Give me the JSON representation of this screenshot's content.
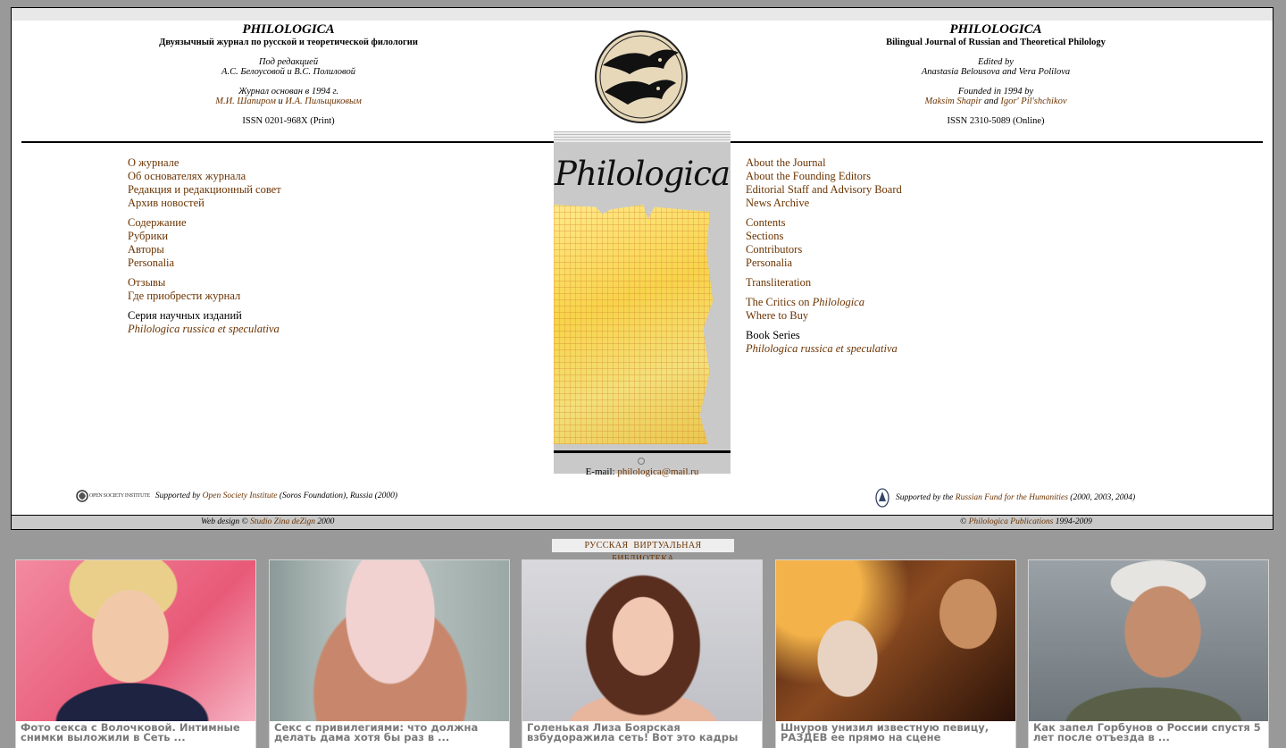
{
  "header_ru": {
    "title": "PHILOLOGICA",
    "subtitle": "Двуязычный журнал по русской и теоретической филологии",
    "edited_label": "Под редакцией",
    "editors": "А.С. Белоусовой и В.С. Полиловой",
    "founded_label": "Журнал основан в 1994 г.",
    "founder1": "М.И. Шапиром",
    "founder_conj": "и",
    "founder2": "И.А. Пильщиковым",
    "issn": "ISSN 0201-968X (Print)"
  },
  "header_en": {
    "title": "PHILOLOGICA",
    "subtitle": "Bilingual Journal of Russian and Theoretical Philology",
    "edited_label": "Edited by",
    "editors": "Anastasia Belousova and Vera Polilova",
    "founded_label": "Founded in 1994 by",
    "founder1": "Maksim Shapir",
    "founder_conj": "and",
    "founder2": "Igor' Pil'shchikov",
    "issn": "ISSN 2310-5089 (Online)"
  },
  "cover": {
    "title": "Philologica",
    "email_label": "E-mail:",
    "email": "philologica@mail.ru"
  },
  "menu_ru": {
    "about": "О журнале",
    "founders": "Об основателях журнала",
    "editorial": "Редакция и редакционный совет",
    "news": "Архив новостей",
    "contents": "Содержание",
    "sections": "Рубрики",
    "authors": "Авторы",
    "personalia": "Personalia",
    "reviews": "Отзывы",
    "buy": "Где приобрести журнал",
    "series_label": "Серия научных изданий",
    "series": "Philologica russica et speculativa"
  },
  "menu_en": {
    "about": "About the Journal",
    "founders": "About the Founding Editors",
    "editorial": "Editorial Staff and Advisory Board",
    "news": "News Archive",
    "contents": "Contents",
    "sections": "Sections",
    "contributors": "Contributors",
    "personalia": "Personalia",
    "transliteration": "Transliteration",
    "critics_prefix": "The Critics on",
    "critics_journal": "Philologica",
    "buy": "Where to Buy",
    "series_label": "Book Series",
    "series": "Philologica russica et speculativa"
  },
  "support_ru": {
    "logo_text": "OPEN SOCIETY INSTITUTE",
    "prefix": "Supported by",
    "link": "Open Society Institute",
    "suffix": "(Soros Foundation), Russia (2000)"
  },
  "support_en": {
    "prefix": "Supported by the",
    "link": "Russian Fund for the Humanities",
    "suffix": "(2000, 2003, 2004)"
  },
  "footer": {
    "design_prefix": "Web design ©",
    "design_link": "Studio Zina deZign",
    "design_year": "2000",
    "copy_prefix": "©",
    "copy_link": "Philologica Publications",
    "copy_years": "1994-2009"
  },
  "library_link": "РУССКАЯ ВИРТУАЛЬНАЯ БИБЛИОТЕКА",
  "ads": [
    {
      "caption": "Фото секса с Волочковой. Интимные снимки выложили в Сеть ..."
    },
    {
      "caption": "Секс с привилегиями: что должна делать дама хотя бы раз в ..."
    },
    {
      "caption": "Голенькая Лиза Боярская взбудоражила сеть! Вот это кадры"
    },
    {
      "caption": "Шнуров унизил известную певицу, РАЗДЕВ ее прямо на сцене"
    },
    {
      "caption": "Как запел Горбунов о России спустя 5 лет после отъезда в ..."
    }
  ],
  "colors": {
    "link": "#6b3300",
    "page_bg": "#999999",
    "panel_grey": "#c9c9c9"
  }
}
